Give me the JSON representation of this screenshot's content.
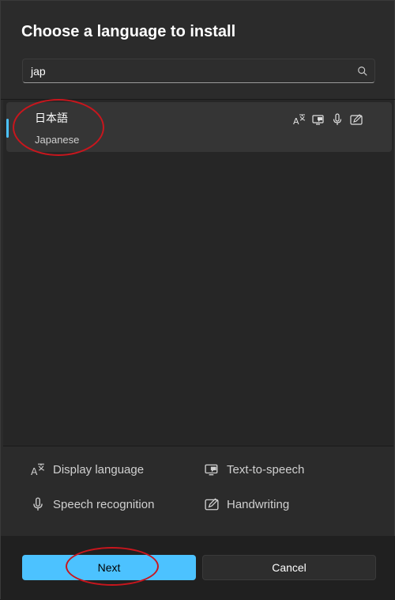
{
  "dialog": {
    "title": "Choose a language to install"
  },
  "search": {
    "value": "jap",
    "icon": "search-icon"
  },
  "results": [
    {
      "native": "日本語",
      "english": "Japanese",
      "features": [
        "display-language-icon",
        "text-to-speech-icon",
        "speech-recognition-icon",
        "handwriting-icon"
      ]
    }
  ],
  "legend": {
    "display_language": "Display language",
    "text_to_speech": "Text-to-speech",
    "speech_recognition": "Speech recognition",
    "handwriting": "Handwriting"
  },
  "buttons": {
    "next": "Next",
    "cancel": "Cancel"
  },
  "colors": {
    "accent": "#4cc2ff",
    "annotation": "#c8161d"
  }
}
